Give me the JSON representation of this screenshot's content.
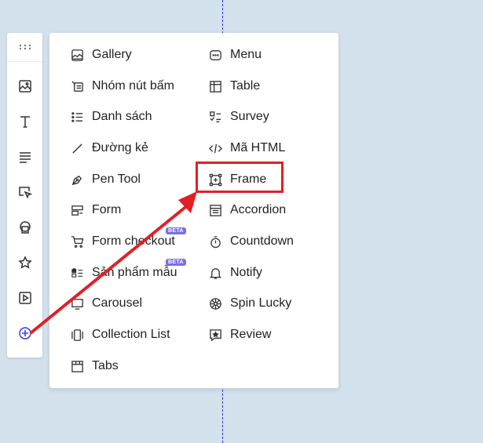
{
  "menu": {
    "left": [
      {
        "label": "Gallery",
        "icon": "gallery-icon"
      },
      {
        "label": "Nhóm nút bấm",
        "icon": "button-group-icon"
      },
      {
        "label": "Danh sách",
        "icon": "list-icon"
      },
      {
        "label": "Đường kẻ",
        "icon": "line-icon"
      },
      {
        "label": "Pen Tool",
        "icon": "pen-tool-icon"
      },
      {
        "label": "Form",
        "icon": "form-icon"
      },
      {
        "label": "Form checkout",
        "icon": "cart-icon",
        "badge": "BETA"
      },
      {
        "label": "Sản phẩm mẫu",
        "icon": "product-sample-icon",
        "badge": "BETA"
      },
      {
        "label": "Carousel",
        "icon": "carousel-icon"
      },
      {
        "label": "Collection List",
        "icon": "collection-list-icon"
      },
      {
        "label": "Tabs",
        "icon": "tabs-icon"
      }
    ],
    "right": [
      {
        "label": "Menu",
        "icon": "menu-icon"
      },
      {
        "label": "Table",
        "icon": "table-icon"
      },
      {
        "label": "Survey",
        "icon": "survey-icon"
      },
      {
        "label": "Mã HTML",
        "icon": "code-icon"
      },
      {
        "label": "Frame",
        "icon": "frame-icon"
      },
      {
        "label": "Accordion",
        "icon": "accordion-icon"
      },
      {
        "label": "Countdown",
        "icon": "timer-icon"
      },
      {
        "label": "Notify",
        "icon": "bell-icon"
      },
      {
        "label": "Spin Lucky",
        "icon": "spin-wheel-icon"
      },
      {
        "label": "Review",
        "icon": "review-icon"
      }
    ]
  },
  "toolbar": {
    "icons": [
      "drag-handle-icon",
      "image-icon",
      "text-icon",
      "paragraph-icon",
      "select-icon",
      "shape-icon",
      "star-icon",
      "video-icon",
      "add-icon"
    ]
  },
  "colors": {
    "badge": "#7a6ee6",
    "highlight": "#e21f26",
    "add_icon": "#3a3ad6",
    "guide": "#2b2bd1"
  }
}
